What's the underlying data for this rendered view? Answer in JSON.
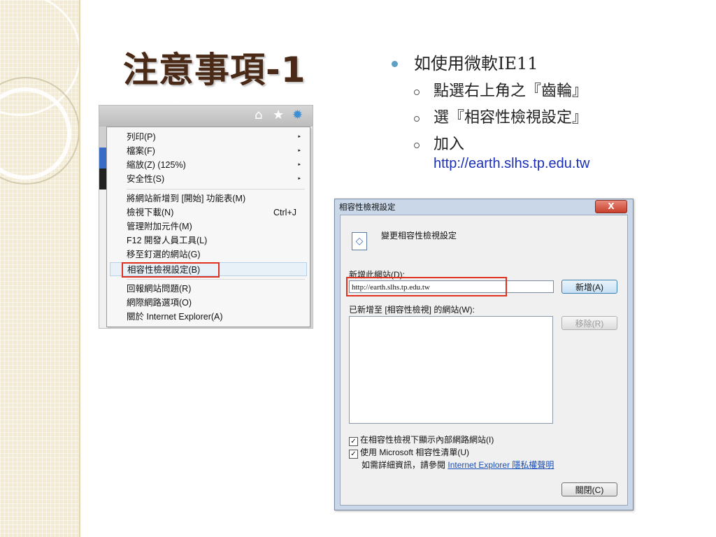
{
  "slide": {
    "title": "注意事項-1",
    "bullets": {
      "main": "如使用微軟IE11",
      "sub": [
        "點選右上角之『齒輪』",
        "選『相容性檢視設定』",
        "加入"
      ],
      "url": "http://earth.slhs.tp.edu.tw"
    }
  },
  "ie_menu": {
    "toolbar_icons": [
      "home-icon",
      "star-icon",
      "gear-icon"
    ],
    "items": [
      {
        "label": "列印(P)",
        "submenu": true
      },
      {
        "label": "檔案(F)",
        "submenu": true
      },
      {
        "label": "縮放(Z) (125%)",
        "submenu": true
      },
      {
        "label": "安全性(S)",
        "submenu": true
      },
      {
        "label": "將網站新增到 [開始] 功能表(M)"
      },
      {
        "label": "檢視下載(N)",
        "shortcut": "Ctrl+J"
      },
      {
        "label": "管理附加元件(M)"
      },
      {
        "label": "F12 開發人員工具(L)"
      },
      {
        "label": "移至釘選的網站(G)"
      },
      {
        "label": "相容性檢視設定(B)",
        "highlighted": true
      },
      {
        "label": "回報網站問題(R)"
      },
      {
        "label": "網際網路選項(O)"
      },
      {
        "label": "關於 Internet Explorer(A)"
      }
    ],
    "submenu_glyph": "▸"
  },
  "dialog": {
    "title": "相容性檢視設定",
    "close_glyph": "X",
    "heading": "變更相容性檢視設定",
    "add_label": "新增此網站(D):",
    "input_value": "http://earth.slhs.tp.edu.tw",
    "add_button": "新增(A)",
    "list_label": "已新增至 [相容性檢視] 的網站(W):",
    "remove_button": "移除(R)",
    "check1": "在相容性檢視下顯示內部網路網站(I)",
    "check2": "使用 Microsoft 相容性清單(U)",
    "check_glyph": "✓",
    "info_prefix": "如需詳細資訊，請參閱",
    "info_link": "Internet Explorer 隱私權聲明",
    "close_button": "關閉(C)"
  },
  "colors": {
    "title": "#4a2a16",
    "bullet": "#5fa0c5",
    "url": "#1a2fb8",
    "highlight_box": "#e03020"
  }
}
